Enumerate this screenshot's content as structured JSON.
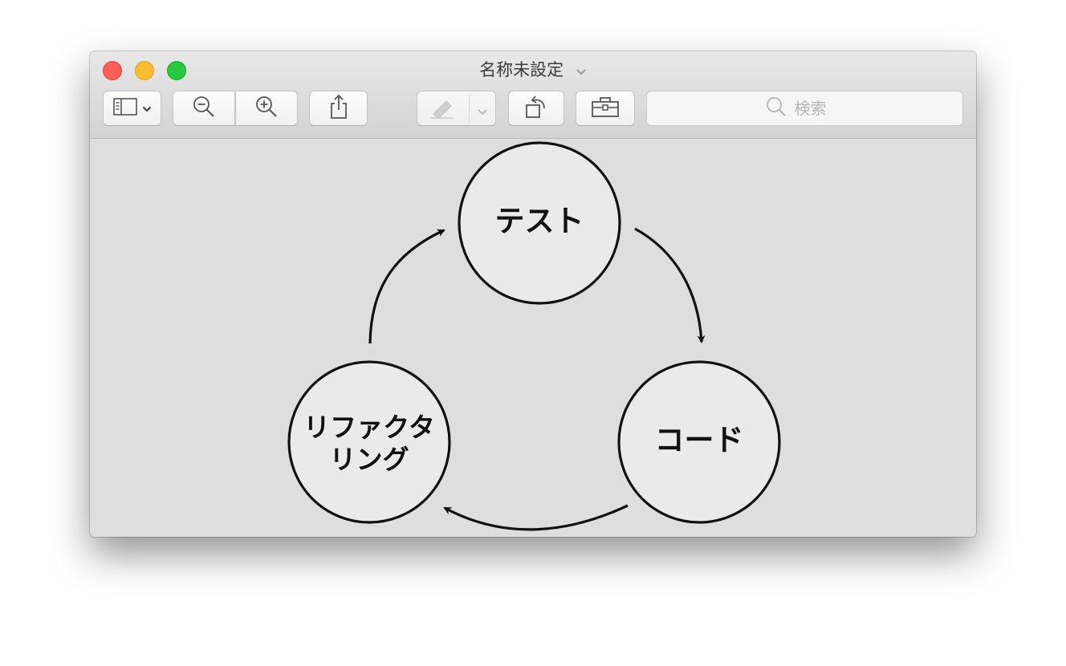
{
  "window": {
    "title": "名称未設定"
  },
  "toolbar": {
    "sidebar_button": "sidebar-toggle",
    "zoom_out": "zoom-out",
    "zoom_in": "zoom-in",
    "share": "share",
    "markup": "markup",
    "rotate": "rotate",
    "toolbox": "toolbox"
  },
  "search": {
    "placeholder": "検索"
  },
  "diagram": {
    "nodes": [
      {
        "id": "test",
        "label": "テスト"
      },
      {
        "id": "code",
        "label": "コード"
      },
      {
        "id": "refactor",
        "label_line1": "リファクタ",
        "label_line2": "リング"
      }
    ],
    "edges": [
      {
        "from": "test",
        "to": "code"
      },
      {
        "from": "code",
        "to": "refactor"
      },
      {
        "from": "refactor",
        "to": "test"
      }
    ]
  },
  "colors": {
    "close": "#fd5f57",
    "minimize": "#fdbc2e",
    "maximize": "#28c840",
    "canvas": "#dedede",
    "node_fill": "#eaeaea",
    "stroke": "#111111"
  }
}
